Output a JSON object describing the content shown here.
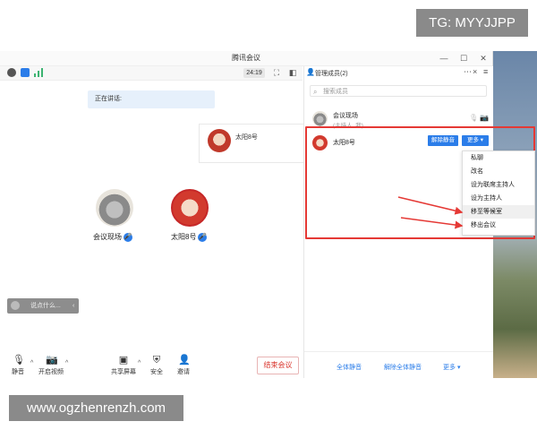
{
  "watermarks": {
    "tg": "TG: MYYJJPP",
    "url": "www.ogzhenrenzh.com"
  },
  "window": {
    "title": "腾讯会议",
    "controls": [
      "—",
      "☐",
      "✕"
    ]
  },
  "toolbar": {
    "timer": "24:19"
  },
  "speaking": {
    "label": "正在讲话:"
  },
  "tile": {
    "name": "太阳8号"
  },
  "participants": [
    {
      "name": "会议现场",
      "mic": "active"
    },
    {
      "name": "太阳8号",
      "mic": "active"
    }
  ],
  "chat": {
    "placeholder": "说点什么...",
    "arrow": "‹"
  },
  "bottom_bar": {
    "mute": "静音",
    "video": "开启视频",
    "share": "共享屏幕",
    "security": "安全",
    "invite": "邀请",
    "end": "结束会议"
  },
  "panel": {
    "title": "管理成员(2)",
    "search_placeholder": "搜索成员",
    "members": [
      {
        "name": "会议现场",
        "sub": "(主持人, 我)"
      },
      {
        "name": "太阳8号",
        "unmute_label": "解除静音",
        "more_label": "更多 ▾"
      }
    ],
    "footer": {
      "mute_all": "全体静音",
      "unmute_all": "解除全体静音",
      "more": "更多 ▾"
    }
  },
  "dropdown": {
    "items": [
      "私聊",
      "改名",
      "设为联席主持人",
      "设为主持人",
      "移至等候室",
      "移出会议"
    ],
    "highlighted_index": 4
  },
  "colors": {
    "accent": "#2b7de9",
    "danger": "#e53935",
    "end_text": "#d9342b"
  }
}
